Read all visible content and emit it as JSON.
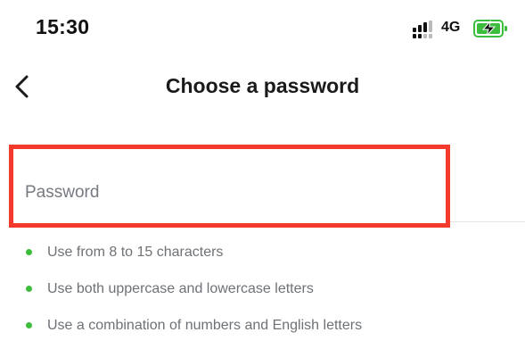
{
  "status_bar": {
    "time": "15:30",
    "network": "4G",
    "signal_icon": "cellular-signal-icon",
    "battery_icon": "battery-charging-icon",
    "battery_color": "#3dbd3d"
  },
  "header": {
    "back_icon": "chevron-left-icon",
    "title": "Choose a password"
  },
  "form": {
    "password_placeholder": "Password",
    "password_value": "",
    "highlight_color": "#f43a2d"
  },
  "rules": [
    "Use from 8 to 15 characters",
    "Use both uppercase and lowercase letters",
    "Use a combination of numbers and English letters"
  ],
  "colors": {
    "bullet": "#3dbd3d",
    "rule_text": "#6e7276",
    "title": "#1a1a1a"
  }
}
